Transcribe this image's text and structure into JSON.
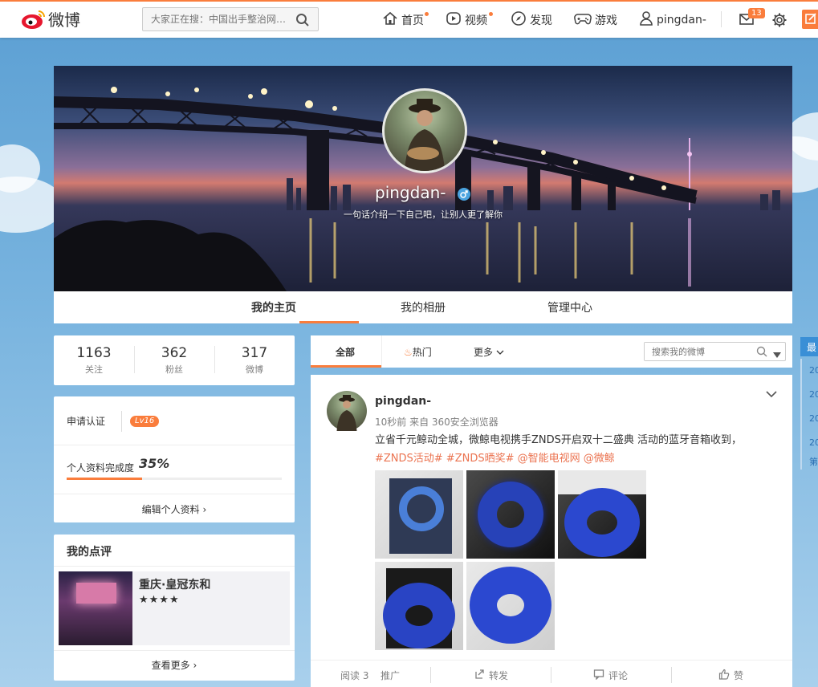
{
  "topbar": {
    "logo_text": "微博",
    "search_placeholder": "大家正在搜：中国出手整治网…",
    "nav": [
      {
        "label": "首页",
        "icon": "home-icon"
      },
      {
        "label": "视频",
        "icon": "video-icon"
      },
      {
        "label": "发现",
        "icon": "compass-icon"
      },
      {
        "label": "游戏",
        "icon": "gamepad-icon"
      },
      {
        "label": "pingdan-",
        "icon": "user-icon"
      }
    ],
    "message_count": "13"
  },
  "profile": {
    "username": "pingdan-",
    "intro": "一句话介绍一下自己吧，让别人更了解你",
    "tabs": [
      "我的主页",
      "我的相册",
      "管理中心"
    ]
  },
  "stats": [
    {
      "num": "1163",
      "label": "关注"
    },
    {
      "num": "362",
      "label": "粉丝"
    },
    {
      "num": "317",
      "label": "微博"
    }
  ],
  "cert": {
    "apply_label": "申请认证",
    "level": "Lv16",
    "completion_label": "个人资料完成度",
    "completion_value": "35%",
    "completion_fraction": 0.35,
    "edit_label": "编辑个人资料"
  },
  "review": {
    "title": "我的点评",
    "name": "重庆·皇冠东和",
    "stars": "★★★★",
    "more_label": "查看更多"
  },
  "feed": {
    "tabs": [
      "全部",
      "热门",
      "更多"
    ],
    "search_placeholder": "搜索我的微博"
  },
  "post": {
    "author": "pingdan-",
    "meta": "10秒前 来自 360安全浏览器",
    "text": "立省千元鲸动全城，微鲸电视携手ZNDS开启双十二盛典  活动的蓝牙音箱收到，",
    "tags": "#ZNDS活动# #ZNDS晒奖# @智能电视网  @微鲸",
    "footer": {
      "read": "阅读 3",
      "promote": "推广",
      "repost": "转发",
      "comment": "评论",
      "like": "赞"
    }
  },
  "side_strip": {
    "label": "最",
    "dates": [
      "20",
      "20",
      "20",
      "20"
    ],
    "footer": "第"
  },
  "colors": {
    "accent": "#fa7d3c",
    "link": "#eb7350"
  }
}
